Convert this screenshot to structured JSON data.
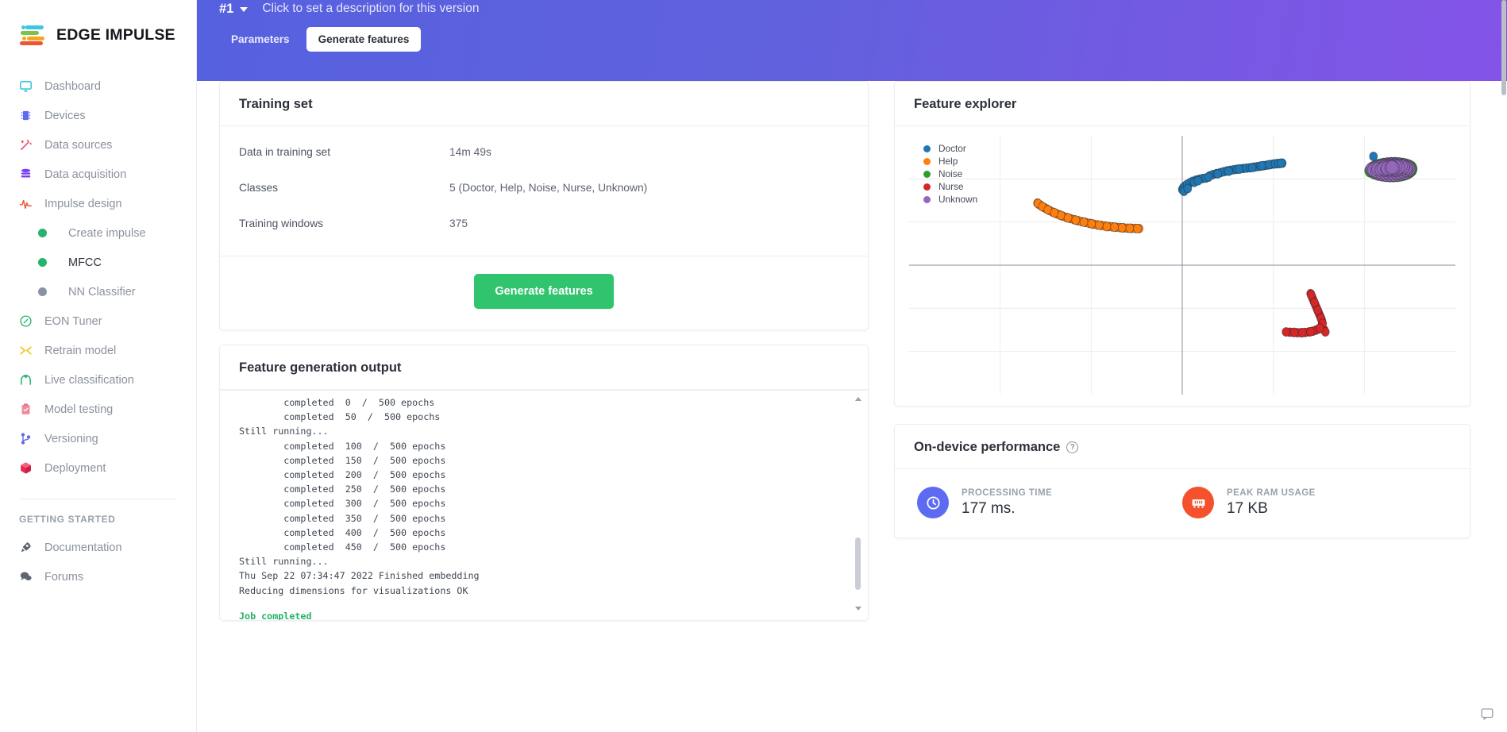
{
  "brand": {
    "name": "EDGE IMPULSE"
  },
  "sidebar": {
    "items": [
      {
        "label": "Dashboard",
        "icon": "monitor-icon",
        "color": "#3ec6e0"
      },
      {
        "label": "Devices",
        "icon": "chip-icon",
        "color": "#5c6bf2"
      },
      {
        "label": "Data sources",
        "icon": "wand-icon",
        "color": "#ef4c6a"
      },
      {
        "label": "Data acquisition",
        "icon": "database-icon",
        "color": "#7b3ff2"
      },
      {
        "label": "Impulse design",
        "icon": "pulse-icon",
        "color": "#ef5b3c"
      }
    ],
    "sub_items": [
      {
        "label": "Create impulse",
        "state": "green"
      },
      {
        "label": "MFCC",
        "state": "green",
        "active": true
      },
      {
        "label": "NN Classifier",
        "state": "grey"
      }
    ],
    "items2": [
      {
        "label": "EON Tuner",
        "icon": "compass-icon",
        "color": "#26b36b"
      },
      {
        "label": "Retrain model",
        "icon": "shuffle-icon",
        "color": "#f5c518"
      },
      {
        "label": "Live classification",
        "icon": "arch-icon",
        "color": "#26b36b"
      },
      {
        "label": "Model testing",
        "icon": "clipboard-check-icon",
        "color": "#f08a9b"
      },
      {
        "label": "Versioning",
        "icon": "git-branch-icon",
        "color": "#5c6bf2"
      },
      {
        "label": "Deployment",
        "icon": "cube-icon",
        "color": "#e8294f"
      }
    ],
    "section_title": "GETTING STARTED",
    "items3": [
      {
        "label": "Documentation",
        "icon": "rocket-icon",
        "color": "#5d6470"
      },
      {
        "label": "Forums",
        "icon": "chat-icon",
        "color": "#5d6470"
      }
    ]
  },
  "header": {
    "version": "#1",
    "description": "Click to set a description for this version",
    "tabs": [
      {
        "label": "Parameters",
        "active": false
      },
      {
        "label": "Generate features",
        "active": true
      }
    ]
  },
  "training_set": {
    "title": "Training set",
    "rows": [
      {
        "key": "Data in training set",
        "value": "14m 49s"
      },
      {
        "key": "Classes",
        "value": "5 (Doctor, Help, Noise, Nurse, Unknown)"
      },
      {
        "key": "Training windows",
        "value": "375"
      }
    ],
    "generate_button": "Generate features"
  },
  "feature_output": {
    "title": "Feature generation output",
    "log": "        completed  0  /  500 epochs\n        completed  50  /  500 epochs\nStill running...\n        completed  100  /  500 epochs\n        completed  150  /  500 epochs\n        completed  200  /  500 epochs\n        completed  250  /  500 epochs\n        completed  300  /  500 epochs\n        completed  350  /  500 epochs\n        completed  400  /  500 epochs\n        completed  450  /  500 epochs\nStill running...\nThu Sep 22 07:34:47 2022 Finished embedding\nReducing dimensions for visualizations OK\n",
    "job_completed": "Job completed"
  },
  "feature_explorer": {
    "title": "Feature explorer"
  },
  "on_device": {
    "title": "On-device performance",
    "help_icon": "?",
    "metrics": [
      {
        "label": "PROCESSING TIME",
        "value": "177 ms.",
        "icon": "clock-icon",
        "color": "#5c6bf2"
      },
      {
        "label": "PEAK RAM USAGE",
        "value": "17 KB",
        "icon": "ram-icon",
        "color": "#f4512c"
      }
    ]
  },
  "chart_data": {
    "type": "scatter",
    "title": "Feature explorer",
    "xlabel": "",
    "ylabel": "",
    "grid": true,
    "legend_position": "top-left",
    "axes": {
      "x_zero_line": true,
      "y_zero_line": true,
      "xlim": [
        -1,
        1
      ],
      "ylim": [
        -1,
        1
      ]
    },
    "series": [
      {
        "name": "Doctor",
        "color": "#1f77b4",
        "points": [
          [
            0.0,
            0.585
          ],
          [
            0.004,
            0.6
          ],
          [
            0.01,
            0.612
          ],
          [
            0.018,
            0.625
          ],
          [
            0.028,
            0.637
          ],
          [
            0.038,
            0.648
          ],
          [
            0.05,
            0.657
          ],
          [
            0.062,
            0.664
          ],
          [
            0.074,
            0.669
          ],
          [
            0.086,
            0.673
          ],
          [
            0.1,
            0.69
          ],
          [
            0.112,
            0.7
          ],
          [
            0.126,
            0.708
          ],
          [
            0.14,
            0.715
          ],
          [
            0.152,
            0.722
          ],
          [
            0.164,
            0.728
          ],
          [
            0.176,
            0.733
          ],
          [
            0.188,
            0.737
          ],
          [
            0.2,
            0.741
          ],
          [
            0.212,
            0.744
          ],
          [
            0.224,
            0.747
          ],
          [
            0.236,
            0.75
          ],
          [
            0.248,
            0.753
          ],
          [
            0.262,
            0.757
          ],
          [
            0.274,
            0.761
          ],
          [
            0.286,
            0.765
          ],
          [
            0.298,
            0.769
          ],
          [
            0.31,
            0.773
          ],
          [
            0.322,
            0.777
          ],
          [
            0.334,
            0.781
          ],
          [
            0.346,
            0.784
          ],
          [
            0.356,
            0.786
          ],
          [
            0.366,
            0.788
          ],
          [
            0.006,
            0.57
          ],
          [
            0.02,
            0.592
          ],
          [
            0.044,
            0.64
          ],
          [
            0.058,
            0.652
          ],
          [
            0.096,
            0.68
          ],
          [
            0.13,
            0.706
          ],
          [
            0.17,
            0.726
          ],
          [
            0.208,
            0.742
          ],
          [
            0.256,
            0.754
          ],
          [
            0.292,
            0.768
          ],
          [
            0.318,
            0.776
          ],
          [
            0.34,
            0.783
          ],
          [
            0.352,
            0.786
          ],
          [
            0.362,
            0.789
          ],
          [
            0.7,
            0.84
          ]
        ]
      },
      {
        "name": "Help",
        "color": "#ff7f0e",
        "points": [
          [
            -0.53,
            0.48
          ],
          [
            -0.524,
            0.47
          ],
          [
            -0.516,
            0.458
          ],
          [
            -0.506,
            0.446
          ],
          [
            -0.496,
            0.434
          ],
          [
            -0.486,
            0.422
          ],
          [
            -0.474,
            0.41
          ],
          [
            -0.462,
            0.399
          ],
          [
            -0.45,
            0.389
          ],
          [
            -0.438,
            0.379
          ],
          [
            -0.424,
            0.369
          ],
          [
            -0.41,
            0.36
          ],
          [
            -0.396,
            0.352
          ],
          [
            -0.382,
            0.344
          ],
          [
            -0.368,
            0.336
          ],
          [
            -0.354,
            0.33
          ],
          [
            -0.34,
            0.323
          ],
          [
            -0.326,
            0.317
          ],
          [
            -0.312,
            0.312
          ],
          [
            -0.298,
            0.307
          ],
          [
            -0.284,
            0.303
          ],
          [
            -0.27,
            0.299
          ],
          [
            -0.256,
            0.296
          ],
          [
            -0.242,
            0.293
          ],
          [
            -0.228,
            0.29
          ],
          [
            -0.214,
            0.288
          ],
          [
            -0.2,
            0.286
          ],
          [
            -0.186,
            0.285
          ],
          [
            -0.172,
            0.284
          ],
          [
            -0.158,
            0.283
          ],
          [
            -0.528,
            0.476
          ],
          [
            -0.512,
            0.452
          ],
          [
            -0.492,
            0.428
          ],
          [
            -0.468,
            0.405
          ],
          [
            -0.444,
            0.384
          ],
          [
            -0.418,
            0.365
          ],
          [
            -0.39,
            0.348
          ],
          [
            -0.36,
            0.333
          ],
          [
            -0.332,
            0.32
          ],
          [
            -0.304,
            0.309
          ],
          [
            -0.276,
            0.298
          ],
          [
            -0.248,
            0.294
          ],
          [
            -0.22,
            0.289
          ],
          [
            -0.192,
            0.285
          ],
          [
            -0.164,
            0.283
          ]
        ]
      },
      {
        "name": "Noise",
        "color": "#2ca02c",
        "points": [
          [
            0.69,
            0.73
          ],
          [
            0.704,
            0.716
          ],
          [
            0.718,
            0.706
          ],
          [
            0.732,
            0.7
          ],
          [
            0.746,
            0.696
          ],
          [
            0.76,
            0.694
          ],
          [
            0.774,
            0.694
          ],
          [
            0.788,
            0.696
          ],
          [
            0.8,
            0.7
          ],
          [
            0.812,
            0.706
          ],
          [
            0.822,
            0.714
          ],
          [
            0.83,
            0.724
          ],
          [
            0.836,
            0.734
          ],
          [
            0.838,
            0.744
          ],
          [
            0.836,
            0.754
          ],
          [
            0.83,
            0.762
          ],
          [
            0.82,
            0.77
          ],
          [
            0.808,
            0.776
          ],
          [
            0.794,
            0.78
          ],
          [
            0.78,
            0.782
          ],
          [
            0.766,
            0.782
          ],
          [
            0.752,
            0.78
          ],
          [
            0.738,
            0.776
          ],
          [
            0.724,
            0.77
          ],
          [
            0.712,
            0.762
          ],
          [
            0.702,
            0.752
          ],
          [
            0.694,
            0.742
          ]
        ]
      },
      {
        "name": "Nurse",
        "color": "#d62728",
        "points": [
          [
            0.47,
            -0.22
          ],
          [
            0.474,
            -0.24
          ],
          [
            0.478,
            -0.26
          ],
          [
            0.482,
            -0.28
          ],
          [
            0.486,
            -0.3
          ],
          [
            0.49,
            -0.32
          ],
          [
            0.494,
            -0.34
          ],
          [
            0.498,
            -0.36
          ],
          [
            0.502,
            -0.38
          ],
          [
            0.506,
            -0.4
          ],
          [
            0.51,
            -0.42
          ],
          [
            0.512,
            -0.44
          ],
          [
            0.512,
            -0.46
          ],
          [
            0.508,
            -0.478
          ],
          [
            0.5,
            -0.492
          ],
          [
            0.49,
            -0.502
          ],
          [
            0.478,
            -0.51
          ],
          [
            0.464,
            -0.516
          ],
          [
            0.45,
            -0.52
          ],
          [
            0.436,
            -0.522
          ],
          [
            0.422,
            -0.522
          ],
          [
            0.408,
            -0.52
          ],
          [
            0.394,
            -0.518
          ],
          [
            0.38,
            -0.516
          ],
          [
            0.52,
            -0.5
          ],
          [
            0.524,
            -0.516
          ],
          [
            0.472,
            -0.23
          ],
          [
            0.484,
            -0.29
          ],
          [
            0.496,
            -0.35
          ],
          [
            0.508,
            -0.41
          ],
          [
            0.514,
            -0.45
          ],
          [
            0.504,
            -0.486
          ],
          [
            0.47,
            -0.514
          ],
          [
            0.44,
            -0.521
          ],
          [
            0.41,
            -0.519
          ]
        ]
      },
      {
        "name": "Unknown",
        "color": "#9467bd",
        "points": [
          [
            0.694,
            0.742
          ],
          [
            0.706,
            0.722
          ],
          [
            0.72,
            0.71
          ],
          [
            0.734,
            0.702
          ],
          [
            0.748,
            0.698
          ],
          [
            0.762,
            0.697
          ],
          [
            0.776,
            0.698
          ],
          [
            0.79,
            0.702
          ],
          [
            0.802,
            0.708
          ],
          [
            0.814,
            0.716
          ],
          [
            0.824,
            0.726
          ],
          [
            0.83,
            0.736
          ],
          [
            0.832,
            0.746
          ],
          [
            0.828,
            0.756
          ],
          [
            0.82,
            0.764
          ],
          [
            0.808,
            0.772
          ],
          [
            0.794,
            0.777
          ],
          [
            0.78,
            0.779
          ],
          [
            0.766,
            0.779
          ],
          [
            0.752,
            0.777
          ],
          [
            0.738,
            0.772
          ],
          [
            0.726,
            0.765
          ],
          [
            0.714,
            0.756
          ],
          [
            0.704,
            0.746
          ],
          [
            0.7,
            0.734
          ],
          [
            0.712,
            0.726
          ],
          [
            0.726,
            0.72
          ],
          [
            0.74,
            0.716
          ],
          [
            0.754,
            0.714
          ],
          [
            0.768,
            0.714
          ],
          [
            0.782,
            0.716
          ],
          [
            0.794,
            0.72
          ],
          [
            0.806,
            0.726
          ],
          [
            0.816,
            0.734
          ],
          [
            0.822,
            0.744
          ],
          [
            0.82,
            0.754
          ],
          [
            0.812,
            0.762
          ],
          [
            0.8,
            0.768
          ],
          [
            0.786,
            0.772
          ],
          [
            0.772,
            0.773
          ],
          [
            0.758,
            0.772
          ],
          [
            0.744,
            0.768
          ],
          [
            0.732,
            0.762
          ],
          [
            0.722,
            0.754
          ],
          [
            0.716,
            0.744
          ],
          [
            0.728,
            0.738
          ],
          [
            0.742,
            0.734
          ],
          [
            0.756,
            0.732
          ],
          [
            0.77,
            0.732
          ],
          [
            0.784,
            0.734
          ],
          [
            0.796,
            0.74
          ],
          [
            0.806,
            0.748
          ],
          [
            0.81,
            0.758
          ],
          [
            0.802,
            0.764
          ],
          [
            0.79,
            0.768
          ],
          [
            0.776,
            0.769
          ],
          [
            0.762,
            0.768
          ],
          [
            0.75,
            0.763
          ],
          [
            0.74,
            0.756
          ],
          [
            0.736,
            0.746
          ],
          [
            0.748,
            0.742
          ],
          [
            0.762,
            0.74
          ],
          [
            0.776,
            0.742
          ],
          [
            0.788,
            0.748
          ],
          [
            0.792,
            0.756
          ],
          [
            0.782,
            0.761
          ],
          [
            0.768,
            0.762
          ],
          [
            0.756,
            0.757
          ],
          [
            0.75,
            0.749
          ],
          [
            0.764,
            0.748
          ],
          [
            0.774,
            0.752
          ],
          [
            0.768,
            0.756
          ]
        ]
      }
    ]
  }
}
